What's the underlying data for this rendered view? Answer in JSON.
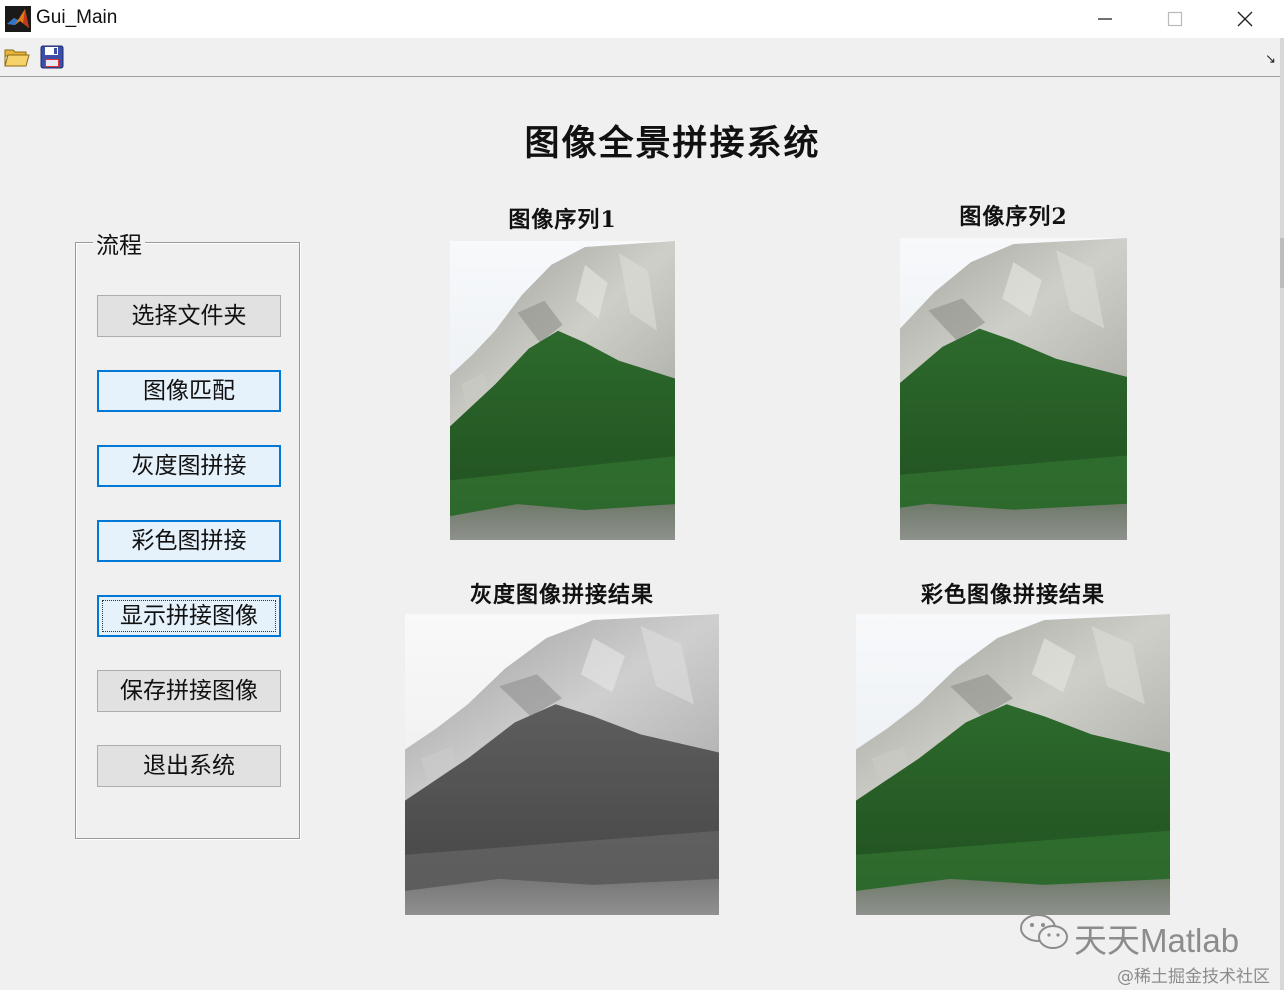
{
  "window": {
    "title": "Gui_Main",
    "minimize_label": "—",
    "maximize_label": "☐",
    "close_label": "✕"
  },
  "toolbar": {
    "open_icon": "folder-open-icon",
    "save_icon": "floppy-save-icon"
  },
  "main_title": "图像全景拼接系统",
  "panel": {
    "title": "流程",
    "buttons": [
      {
        "label": "选择文件夹"
      },
      {
        "label": "图像匹配"
      },
      {
        "label": "灰度图拼接"
      },
      {
        "label": "彩色图拼接"
      },
      {
        "label": "显示拼接图像"
      },
      {
        "label": "保存拼接图像"
      },
      {
        "label": "退出系统"
      }
    ]
  },
  "images": {
    "seq1_caption": "图像序列1",
    "seq2_caption": "图像序列2",
    "gray_caption": "灰度图像拼接结果",
    "color_caption": "彩色图像拼接结果"
  },
  "watermark": {
    "brand": "天天Matlab",
    "sub": "@稀土掘金技术社区"
  },
  "colors": {
    "accent": "#0078d7",
    "forest": "#2f6b2a",
    "rock": "#b9b9b3"
  }
}
